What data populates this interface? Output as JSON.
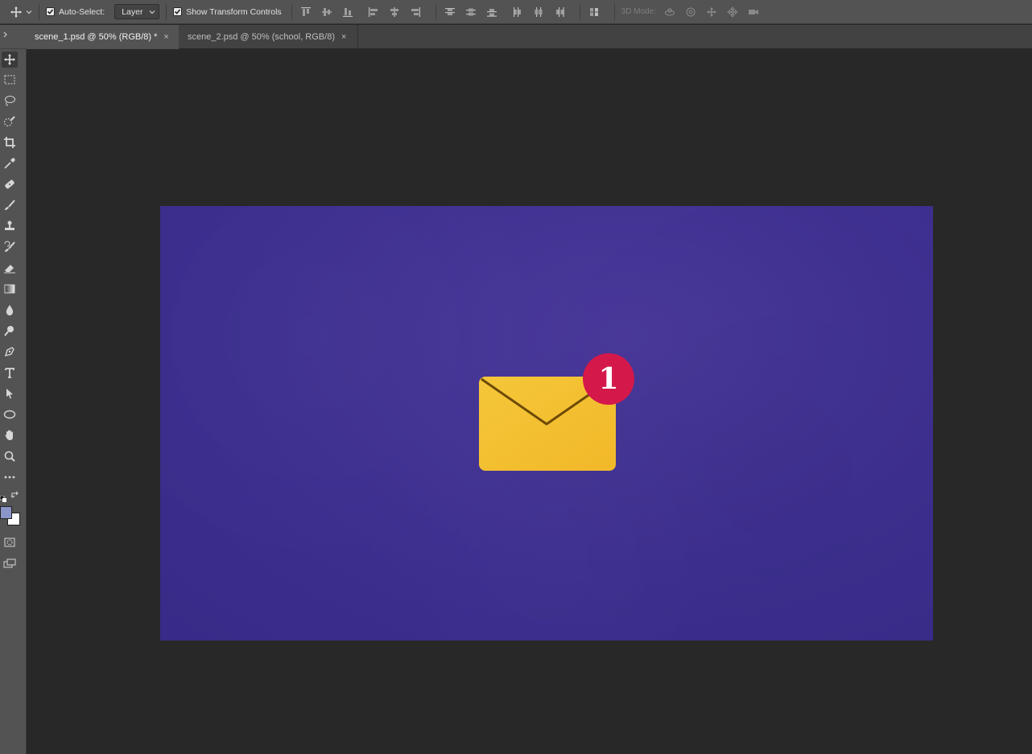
{
  "options_bar": {
    "move_tool_icon": "move-icon",
    "auto_select_label": "Auto-Select:",
    "auto_select_checked": true,
    "layer_select_value": "Layer",
    "show_transform_label": "Show Transform Controls",
    "show_transform_checked": true,
    "mode_3d_label": "3D Mode:"
  },
  "tabs": [
    {
      "label": "scene_1.psd @ 50% (RGB/8) *",
      "close": "×",
      "active": true
    },
    {
      "label": "scene_2.psd @ 50% (school, RGB/8)",
      "close": "×",
      "active": false
    }
  ],
  "tools": [
    "move-tool",
    "marquee-tool",
    "lasso-tool",
    "quick-select-tool",
    "crop-tool",
    "eyedropper-tool",
    "healing-brush-tool",
    "brush-tool",
    "clone-stamp-tool",
    "history-brush-tool",
    "eraser-tool",
    "gradient-tool",
    "blur-tool",
    "dodge-tool",
    "pen-tool",
    "type-tool",
    "path-select-tool",
    "ellipse-tool",
    "hand-tool",
    "zoom-tool",
    "more-tools"
  ],
  "colors": {
    "foreground": "#8b96c8",
    "background": "#ffffff",
    "canvas": "#3d2f8f",
    "envelope": "#f3c232",
    "badge": "#d5184a"
  },
  "canvas": {
    "notification_count": "1"
  }
}
